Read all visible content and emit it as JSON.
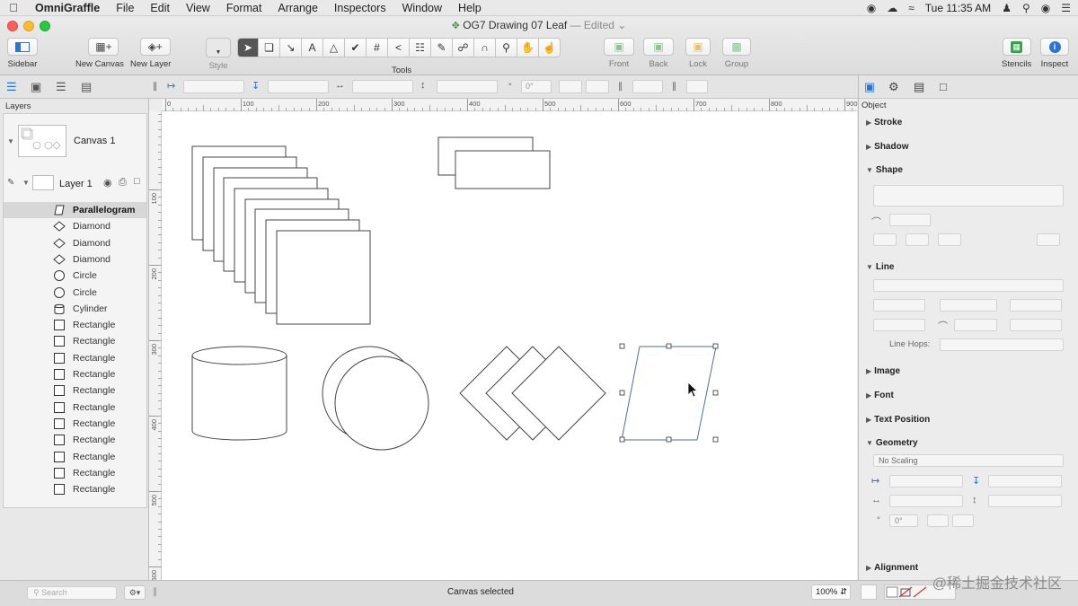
{
  "menubar": {
    "app": "OmniGraffle",
    "items": [
      "File",
      "Edit",
      "View",
      "Format",
      "Arrange",
      "Inspectors",
      "Window",
      "Help"
    ],
    "clock": "Tue 11:35 AM"
  },
  "window": {
    "title": "OG7 Drawing 07 Leaf",
    "state": "— Edited"
  },
  "toolbar": {
    "sidebar": "Sidebar",
    "new_canvas": "New Canvas",
    "new_layer": "New Layer",
    "style": "Style",
    "tools": "Tools",
    "front": "Front",
    "back": "Back",
    "lock": "Lock",
    "group": "Group",
    "stencils": "Stencils",
    "inspect": "Inspect"
  },
  "sidebar": {
    "layers_title": "Layers",
    "canvas_name": "Canvas 1",
    "layer_name": "Layer 1",
    "objects": [
      {
        "name": "Parallelogram",
        "shape": "parallelogram",
        "selected": true
      },
      {
        "name": "Diamond",
        "shape": "diamond"
      },
      {
        "name": "Diamond",
        "shape": "diamond"
      },
      {
        "name": "Diamond",
        "shape": "diamond"
      },
      {
        "name": "Circle",
        "shape": "circle"
      },
      {
        "name": "Circle",
        "shape": "circle"
      },
      {
        "name": "Cylinder",
        "shape": "cylinder"
      },
      {
        "name": "Rectangle",
        "shape": "rect"
      },
      {
        "name": "Rectangle",
        "shape": "rect"
      },
      {
        "name": "Rectangle",
        "shape": "rect"
      },
      {
        "name": "Rectangle",
        "shape": "rect"
      },
      {
        "name": "Rectangle",
        "shape": "rect"
      },
      {
        "name": "Rectangle",
        "shape": "rect"
      },
      {
        "name": "Rectangle",
        "shape": "rect"
      },
      {
        "name": "Rectangle",
        "shape": "rect"
      },
      {
        "name": "Rectangle",
        "shape": "rect"
      },
      {
        "name": "Rectangle",
        "shape": "rect"
      },
      {
        "name": "Rectangle",
        "shape": "rect"
      }
    ],
    "search_placeholder": "Search"
  },
  "subbar": {
    "rotation": "0°"
  },
  "rulers": {
    "top": [
      "0",
      "100",
      "200",
      "300",
      "400",
      "500",
      "600",
      "700",
      "800",
      "900"
    ],
    "left": [
      "100",
      "200",
      "300",
      "400",
      "500",
      "600"
    ]
  },
  "inspector": {
    "section_title": "Object",
    "sections": {
      "stroke": "Stroke",
      "shadow": "Shadow",
      "shape": "Shape",
      "line": "Line",
      "line_hops": "Line Hops:",
      "image": "Image",
      "font": "Font",
      "text_position": "Text Position",
      "geometry": "Geometry",
      "scaling": "No Scaling",
      "rotation": "0°",
      "alignment": "Alignment"
    }
  },
  "status": {
    "text": "Canvas selected",
    "zoom": "100%"
  },
  "watermark": "@稀土掘金技术社区"
}
